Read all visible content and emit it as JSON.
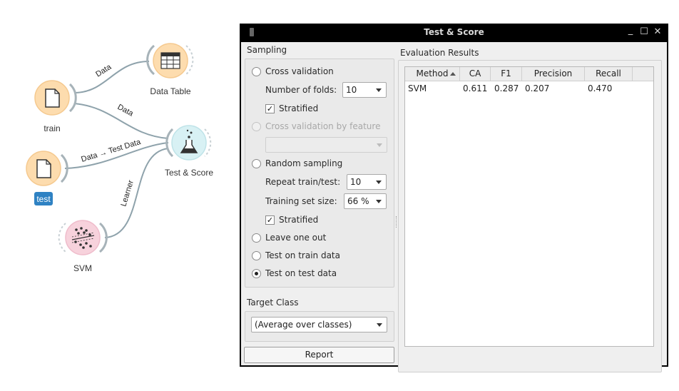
{
  "canvas": {
    "nodes": {
      "train": {
        "label": "train"
      },
      "test": {
        "label": "test"
      },
      "data_table": {
        "label": "Data Table"
      },
      "test_score": {
        "label": "Test & Score"
      },
      "svm": {
        "label": "SVM"
      }
    },
    "links": {
      "train_to_table": "Data",
      "train_to_score": "Data",
      "test_to_score": "Data → Test Data",
      "svm_to_score": "Learner"
    },
    "colors": {
      "data_node": "#fddcae",
      "eval_node": "#d8f1f4",
      "model_node": "#f7d2dc",
      "link": "#8ea2ab",
      "selected_label_bg": "#2f82c3"
    }
  },
  "window": {
    "title": "Test & Score",
    "controls": {
      "minimize": "_",
      "maximize": "☐",
      "close": "✕"
    }
  },
  "sampling": {
    "header": "Sampling",
    "cross_validation": "Cross validation",
    "folds_label": "Number of folds:",
    "folds_value": "10",
    "stratified_label": "Stratified",
    "stratified_check": "✓",
    "cv_by_feature": "Cross validation by feature",
    "random_sampling": "Random sampling",
    "repeat_label": "Repeat train/test:",
    "repeat_value": "10",
    "train_size_label": "Training set size:",
    "train_size_value": "66 %",
    "stratified2_label": "Stratified",
    "stratified2_check": "✓",
    "leave_one_out": "Leave one out",
    "test_on_train": "Test on train data",
    "test_on_test": "Test on test data",
    "selected": "Test on test data"
  },
  "target_class": {
    "header": "Target Class",
    "value": "(Average over classes)"
  },
  "report_button": "Report",
  "results": {
    "header": "Evaluation Results",
    "columns": [
      "Method",
      "CA",
      "F1",
      "Precision",
      "Recall"
    ],
    "rows": [
      {
        "method": "SVM",
        "ca": "0.611",
        "f1": "0.287",
        "precision": "0.207",
        "recall": "0.470"
      }
    ]
  }
}
